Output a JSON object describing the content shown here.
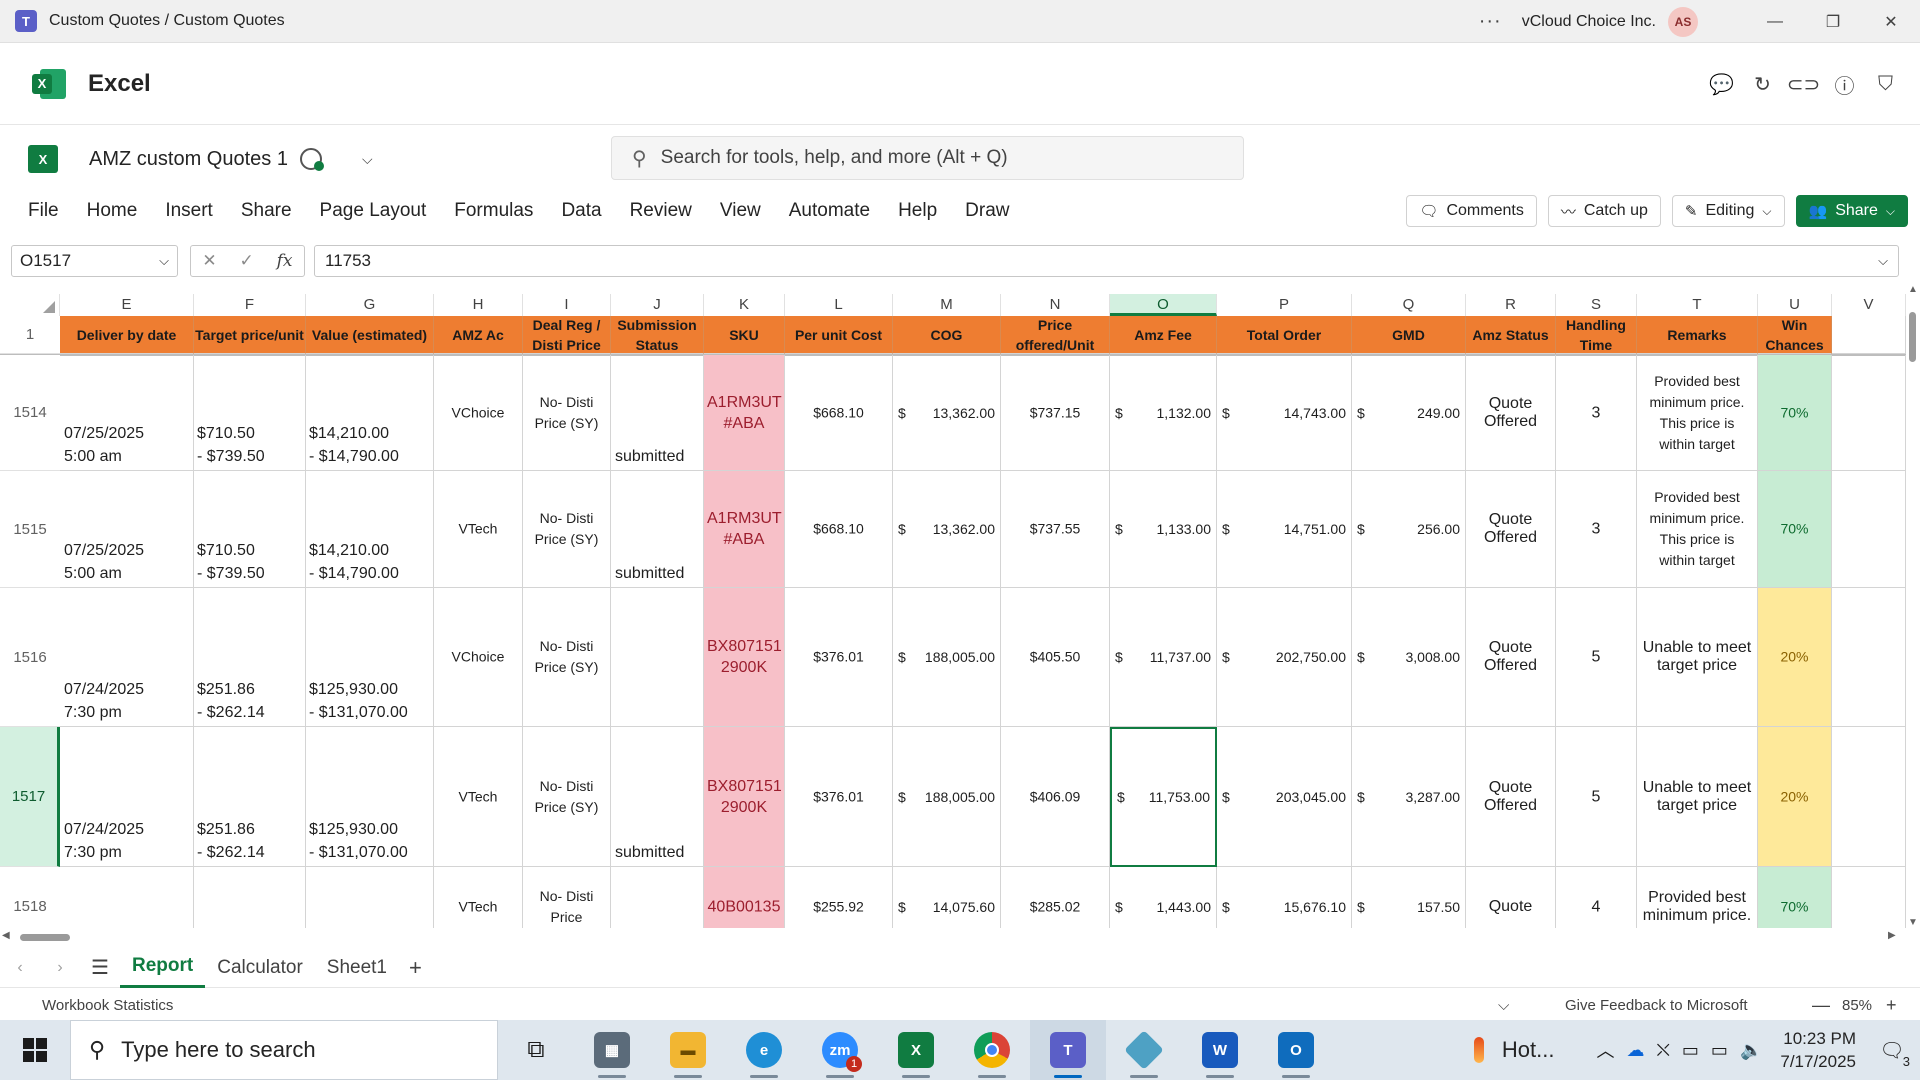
{
  "window": {
    "title": "Custom Quotes / Custom Quotes",
    "org": "vCloud Choice Inc.",
    "avatar_initials": "AS",
    "more_label": "···"
  },
  "app": {
    "name": "Excel"
  },
  "doc": {
    "name": "AMZ custom Quotes 1",
    "search_placeholder": "Search for tools, help, and more (Alt + Q)"
  },
  "ribbon": {
    "tabs": [
      "File",
      "Home",
      "Insert",
      "Share",
      "Page Layout",
      "Formulas",
      "Data",
      "Review",
      "View",
      "Automate",
      "Help",
      "Draw"
    ],
    "comments": "Comments",
    "catchup": "Catch up",
    "editing": "Editing",
    "share": "Share"
  },
  "formula": {
    "cell_ref": "O1517",
    "value": "11753",
    "fx": "fx"
  },
  "columns": [
    "E",
    "F",
    "G",
    "H",
    "I",
    "J",
    "K",
    "L",
    "M",
    "N",
    "O",
    "P",
    "Q",
    "R",
    "S",
    "T",
    "U",
    "V"
  ],
  "header_row": {
    "row_num": "1",
    "cells": [
      "Deliver by date",
      "Target price/unit",
      "Value (estimated)",
      "AMZ Ac",
      "Deal Reg / Disti Price",
      "Submission Status",
      "SKU",
      "Per unit Cost",
      "COG",
      "Price offered/Unit",
      "Amz Fee",
      "Total Order",
      "GMD",
      "Amz Status",
      "Handling Time",
      "Remarks",
      "Win Chances"
    ]
  },
  "rows": [
    {
      "row_num": "1514",
      "date": "07/25/2025",
      "time": "5:00 am",
      "target1": "$710.50",
      "target2": "- $739.50",
      "value1": "$14,210.00",
      "value2": "- $14,790.00",
      "amz_ac": "VChoice",
      "deal": "No- Disti Price (SY)",
      "submission": "submitted",
      "sku": "A1RM3UT #ABA",
      "unit_cost": "$668.10",
      "cog": "13,362.00",
      "price_offered": "$737.15",
      "amz_fee": "1,132.00",
      "total_order": "14,743.00",
      "gmd": "249.00",
      "status": "Quote Offered",
      "handling": "3",
      "remarks": "Provided best minimum price. This price is within target",
      "win": "70%"
    },
    {
      "row_num": "1515",
      "date": "07/25/2025",
      "time": "5:00 am",
      "target1": "$710.50",
      "target2": "- $739.50",
      "value1": "$14,210.00",
      "value2": "- $14,790.00",
      "amz_ac": "VTech",
      "deal": "No- Disti Price (SY)",
      "submission": "submitted",
      "sku": "A1RM3UT #ABA",
      "unit_cost": "$668.10",
      "cog": "13,362.00",
      "price_offered": "$737.55",
      "amz_fee": "1,133.00",
      "total_order": "14,751.00",
      "gmd": "256.00",
      "status": "Quote Offered",
      "handling": "3",
      "remarks": "Provided best minimum price. This price is within target",
      "win": "70%"
    },
    {
      "row_num": "1516",
      "date": "07/24/2025",
      "time": "7:30 pm",
      "target1": "$251.86",
      "target2": "- $262.14",
      "value1": "$125,930.00",
      "value2": "- $131,070.00",
      "amz_ac": "VChoice",
      "deal": "No- Disti Price (SY)",
      "submission": "",
      "sku": "BX807151 2900K",
      "unit_cost": "$376.01",
      "cog": "188,005.00",
      "price_offered": "$405.50",
      "amz_fee": "11,737.00",
      "total_order": "202,750.00",
      "gmd": "3,008.00",
      "status": "Quote Offered",
      "handling": "5",
      "remarks": "Unable to meet target price",
      "win": "20%"
    },
    {
      "row_num": "1517",
      "date": "07/24/2025",
      "time": "7:30 pm",
      "target1": "$251.86",
      "target2": "- $262.14",
      "value1": "$125,930.00",
      "value2": "- $131,070.00",
      "amz_ac": "VTech",
      "deal": "No- Disti Price (SY)",
      "submission": "submitted",
      "sku": "BX807151 2900K",
      "unit_cost": "$376.01",
      "cog": "188,005.00",
      "price_offered": "$406.09",
      "amz_fee": "11,753.00",
      "total_order": "203,045.00",
      "gmd": "3,287.00",
      "status": "Quote Offered",
      "handling": "5",
      "remarks": "Unable to meet target price",
      "win": "20%"
    },
    {
      "row_num": "1518",
      "date": "",
      "time": "",
      "target1": "",
      "target2": "",
      "value1": "",
      "value2": "",
      "amz_ac": "VTech",
      "deal": "No- Disti Price",
      "submission": "",
      "sku": "40B00135",
      "unit_cost": "$255.92",
      "cog": "14,075.60",
      "price_offered": "$285.02",
      "amz_fee": "1,443.00",
      "total_order": "15,676.10",
      "gmd": "157.50",
      "status": "Quote",
      "handling": "4",
      "remarks": "Provided best minimum price.",
      "win": "70%"
    }
  ],
  "currency_symbol": "$",
  "sheets": [
    "Report",
    "Calculator",
    "Sheet1"
  ],
  "status": {
    "workbook_stats": "Workbook Statistics",
    "feedback": "Give Feedback to Microsoft",
    "zoom": "85%"
  },
  "taskbar": {
    "search_placeholder": "Type here to search",
    "weather": "Hot...",
    "time": "10:23 PM",
    "date": "7/17/2025",
    "notif_count": "3",
    "zoom_badge": "1"
  }
}
